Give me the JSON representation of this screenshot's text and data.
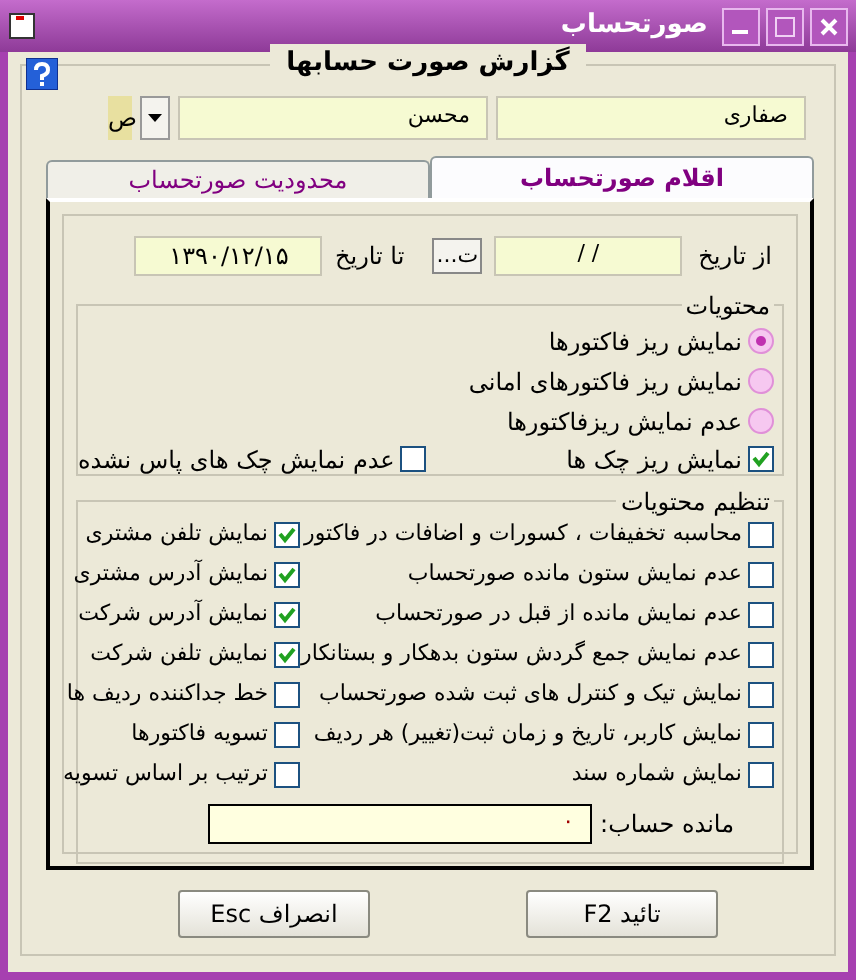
{
  "window": {
    "title": "صورتحساب"
  },
  "heading": "گزارش صورت حسابها",
  "name_fields": [
    {
      "value": "صفاری"
    },
    {
      "value": "محسن"
    }
  ],
  "code_field": {
    "value": "ص"
  },
  "tabs": [
    {
      "label": "اقلام صورتحساب",
      "selected": true
    },
    {
      "label": "محدودیت صورتحساب",
      "selected": false
    }
  ],
  "date_from": {
    "label": "از تاریخ",
    "value": "/ /",
    "button": "ت..."
  },
  "date_to": {
    "label": "تا تاریخ",
    "value": "۱۳۹۰/۱۲/۱۵"
  },
  "contents": {
    "title": "محتویات",
    "options": [
      {
        "label": "نمایش ریز فاکتورها",
        "selected": true
      },
      {
        "label": "نمایش ریز فاکتورهای امانی",
        "selected": false
      },
      {
        "label": "عدم نمایش ریزفاکتورها",
        "selected": false
      }
    ],
    "checks": [
      {
        "label": "نمایش ریز چک ها",
        "checked": true
      },
      {
        "label": "عدم نمایش چک های پاس نشده",
        "checked": false
      }
    ]
  },
  "settings": {
    "title": "تنظیم محتویات",
    "items": [
      {
        "label": "محاسبه تخفیفات ، کسورات و اضافات در فاکتور",
        "checked": false
      },
      {
        "label": "نمایش تلفن مشتری",
        "checked": true
      },
      {
        "label": "عدم نمایش ستون مانده صورتحساب",
        "checked": false
      },
      {
        "label": "نمایش آدرس مشتری",
        "checked": true
      },
      {
        "label": "عدم نمایش مانده از قبل در صورتحساب",
        "checked": false
      },
      {
        "label": "نمایش آدرس شرکت",
        "checked": true
      },
      {
        "label": "عدم نمایش جمع گردش ستون بدهکار و بستانکار",
        "checked": false
      },
      {
        "label": "نمایش تلفن شرکت",
        "checked": true
      },
      {
        "label": "نمایش تیک و کنترل های ثبت شده صورتحساب",
        "checked": false
      },
      {
        "label": "خط جداکننده ردیف ها",
        "checked": false
      },
      {
        "label": "نمایش کاربر، تاریخ و زمان ثبت(تغییر) هر ردیف",
        "checked": false
      },
      {
        "label": "تسویه فاکتورها",
        "checked": false
      },
      {
        "label": "نمایش شماره سند",
        "checked": false
      },
      {
        "label": "ترتیب بر اساس تسویه",
        "checked": false
      }
    ],
    "balance": {
      "label": "مانده حساب:",
      "value": "۰"
    }
  },
  "buttons": [
    "تائید F2",
    "انصراف Esc"
  ]
}
